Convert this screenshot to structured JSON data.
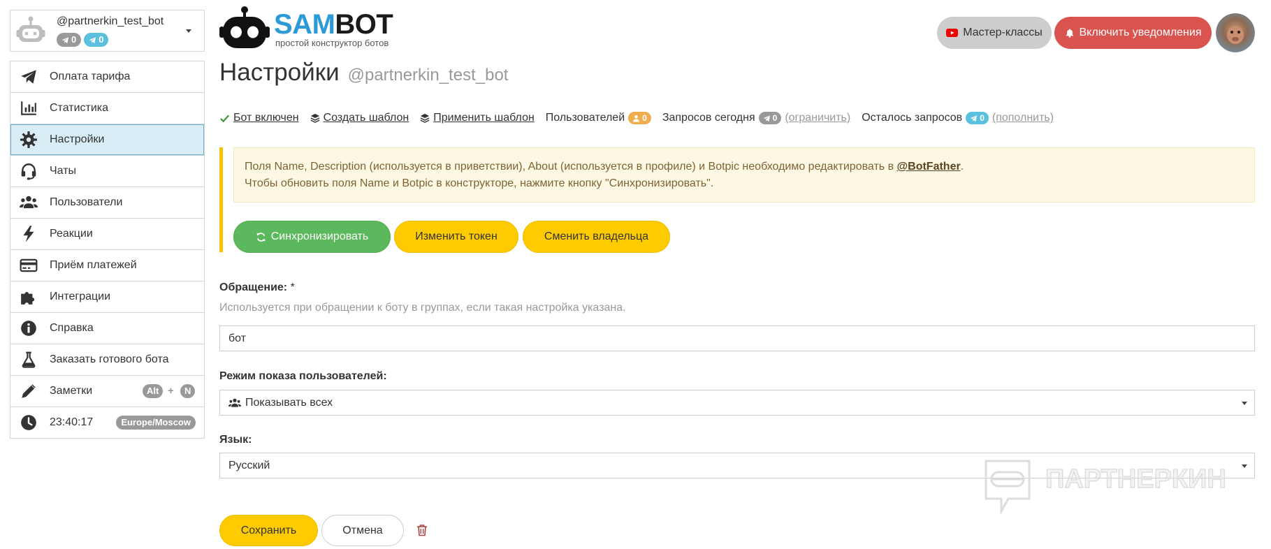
{
  "colors": {
    "brand_blue": "#2d9ad8",
    "success_green": "#5cb85c",
    "warning_yellow": "#fecb00",
    "danger_red": "#d9534f",
    "badge_orange": "#f0ad4e",
    "badge_blue": "#5bc0de",
    "badge_gray": "#999999",
    "active_menu_bg": "#d9edf7",
    "alert_bg": "#fcf8e3"
  },
  "bot": {
    "username": "@partnerkin_test_bot",
    "badge_gray_count": "0",
    "badge_blue_count": "0"
  },
  "sidebar": {
    "items": [
      {
        "label": "Оплата тарифа",
        "icon": "paper-plane-icon"
      },
      {
        "label": "Статистика",
        "icon": "bar-chart-icon"
      },
      {
        "label": "Настройки",
        "icon": "gear-icon",
        "active": true
      },
      {
        "label": "Чаты",
        "icon": "headset-icon"
      },
      {
        "label": "Пользователи",
        "icon": "users-icon"
      },
      {
        "label": "Реакции",
        "icon": "bolt-icon"
      },
      {
        "label": "Приём платежей",
        "icon": "credit-card-icon"
      },
      {
        "label": "Интеграции",
        "icon": "puzzle-icon"
      },
      {
        "label": "Справка",
        "icon": "info-icon"
      },
      {
        "label": "Заказать готового бота",
        "icon": "flask-icon"
      },
      {
        "label": "Заметки",
        "icon": "pencil-icon"
      }
    ],
    "notes_shortcut": {
      "key1": "Alt",
      "plus": "+",
      "key2": "N"
    },
    "clock": {
      "time": "23:40:17",
      "timezone": "Europe/Moscow",
      "icon": "clock-icon"
    }
  },
  "logo": {
    "part1": "SAM",
    "part2": "BOT",
    "tagline": "простой конструктор ботов"
  },
  "header": {
    "masterclass_label": "Мастер-классы",
    "notify_label": "Включить уведомления"
  },
  "page": {
    "title": "Настройки",
    "subtitle": "@partnerkin_test_bot"
  },
  "status": {
    "bot_enabled": "Бот включен",
    "create_template": "Создать шаблон",
    "apply_template": "Применить шаблон",
    "users_label": "Пользователей",
    "users_count": "0",
    "requests_today_label": "Запросов сегодня",
    "requests_today_count": "0",
    "limit_link": "(ограничить)",
    "requests_left_label": "Осталось запросов",
    "requests_left_count": "0",
    "topup_link": "(пополнить)"
  },
  "alert": {
    "line1_pre": "Поля Name, Description (используется в приветствии), About (используется в профиле) и Botpic необходимо редактировать в ",
    "line1_link": "@BotFather",
    "line1_post": ".",
    "line2": "Чтобы обновить поля Name и Botpic в конструкторе, нажмите кнопку \"Синхронизировать\"."
  },
  "alert_actions": {
    "sync": "Синхронизировать",
    "change_token": "Изменить токен",
    "change_owner": "Сменить владельца"
  },
  "form": {
    "address": {
      "label": "Обращение:",
      "required": "*",
      "help": "Используется при обращении к боту в группах, если такая настройка указана.",
      "value": "бот"
    },
    "user_display": {
      "label": "Режим показа пользователей:",
      "value": "Показывать всех"
    },
    "language": {
      "label": "Язык:",
      "value": "Русский"
    }
  },
  "watermark": "ПАРТНЕРКИН",
  "footer": {
    "save": "Сохранить",
    "cancel": "Отмена"
  }
}
